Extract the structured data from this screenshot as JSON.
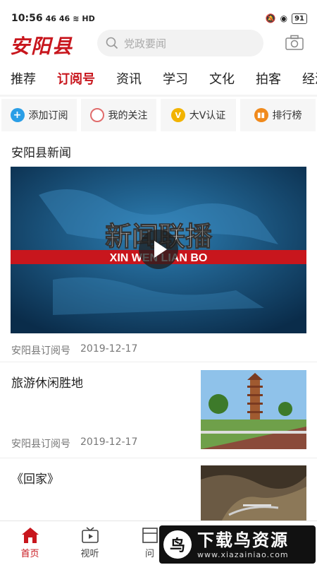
{
  "status_bar": {
    "time": "10:56",
    "signal1": "46",
    "signal2": "46",
    "hd": "HD",
    "battery": "91"
  },
  "header": {
    "logo": "安阳县",
    "search_placeholder": "党政要闻"
  },
  "channel_tabs": [
    "推荐",
    "订阅号",
    "资讯",
    "学习",
    "文化",
    "拍客",
    "经济"
  ],
  "active_tab": "订阅号",
  "quick_actions": [
    {
      "label": "添加订阅",
      "icon": "plus-icon"
    },
    {
      "label": "我的关注",
      "icon": "ring-icon"
    },
    {
      "label": "大V认证",
      "icon": "v-badge-icon"
    },
    {
      "label": "排行榜",
      "icon": "bar-chart-icon"
    }
  ],
  "feed": {
    "section_title": "安阳县新闻",
    "video": {
      "title_cn": "新闻联播",
      "title_en": "XIN WEN LIAN BO",
      "source": "安阳县订阅号",
      "date": "2019-12-17"
    },
    "articles": [
      {
        "title": "旅游休闲胜地",
        "source": "安阳县订阅号",
        "date": "2019-12-17",
        "thumb": "pagoda-photo"
      },
      {
        "title": "《回家》",
        "thumb": "valley-photo"
      }
    ]
  },
  "bottom_nav": [
    {
      "label": "首页",
      "icon": "home-icon",
      "active": true
    },
    {
      "label": "视听",
      "icon": "tv-icon",
      "active": false
    },
    {
      "label": "问",
      "icon": "ask-icon",
      "active": false
    }
  ],
  "watermark": {
    "main": "下载鸟资源",
    "sub": "www.xiazainiao.com"
  },
  "colors": {
    "accent": "#c8161d",
    "watermark_bg": "#111111"
  }
}
